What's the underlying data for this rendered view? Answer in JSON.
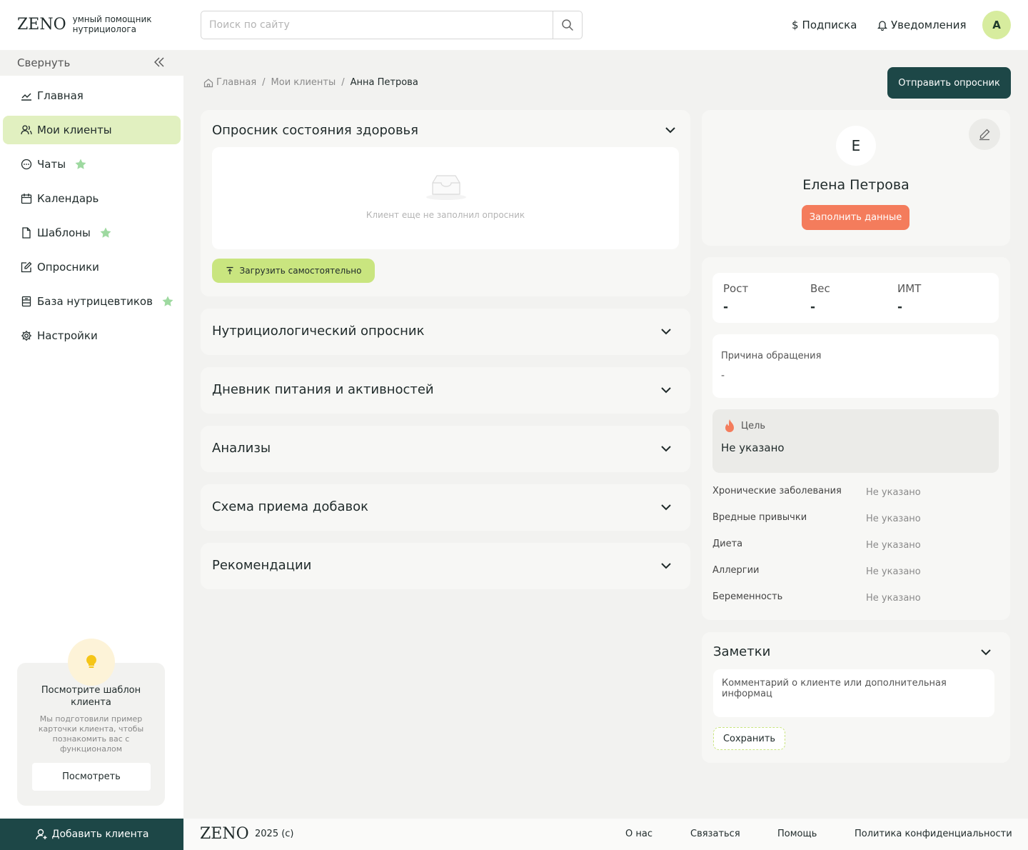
{
  "header": {
    "logo": "ZENO",
    "logo_sub": "умный помощник нутрициолога",
    "search_placeholder": "Поиск по сайту",
    "subscription": "Подписка",
    "notifications": "Уведомления",
    "avatar_letter": "А"
  },
  "sidebar": {
    "collapse_label": "Свернуть",
    "items": [
      {
        "label": "Главная",
        "icon": "chart-line-icon"
      },
      {
        "label": "Мои клиенты",
        "icon": "users-icon"
      },
      {
        "label": "Чаты",
        "icon": "chat-bubble-icon"
      },
      {
        "label": "Календарь",
        "icon": "calendar-icon"
      },
      {
        "label": "Шаблоны",
        "icon": "document-icon"
      },
      {
        "label": "Опросники",
        "icon": "edit-form-icon"
      },
      {
        "label": "База нутрицевтиков",
        "icon": "database-icon"
      },
      {
        "label": "Настройки",
        "icon": "gear-icon"
      }
    ],
    "promo": {
      "title": "Посмотрите шаблон клиента",
      "text": "Мы подготовили пример карточки клиента, чтобы познакомить вас с функционалом",
      "button": "Посмотреть"
    },
    "add_client": "Добавить клиента"
  },
  "breadcrumb": {
    "home": "Главная",
    "clients": "Мои клиенты",
    "current": "Анна Петрова"
  },
  "send_questionnaire": "Отправить опросник",
  "sections": {
    "health": {
      "title": "Опросник  состояния здоровья",
      "empty_text": "Клиент еще не заполнил опросник",
      "upload": "Загрузить самостоятельно"
    },
    "list": [
      "Нутрициологический опросник",
      "Дневник питания и активностей",
      "Анализы",
      "Схема приема добавок",
      "Рекомендации"
    ]
  },
  "profile": {
    "avatar_letter": "Е",
    "name": "Елена Петрова",
    "fill_button": "Заполнить данные",
    "metrics": {
      "height_label": "Рост",
      "height_value": "-",
      "weight_label": "Вес",
      "weight_value": "-",
      "bmi_label": "ИМТ",
      "bmi_value": "-"
    },
    "reason_label": "Причина обращения",
    "reason_value": "-",
    "goal_label": "Цель",
    "goal_value": "Не указано",
    "attributes": [
      {
        "label": "Хронические заболевания",
        "value": "Не указано"
      },
      {
        "label": "Вредные привычки",
        "value": "Не указано"
      },
      {
        "label": "Диета",
        "value": "Не указано"
      },
      {
        "label": "Аллергии",
        "value": "Не указано"
      },
      {
        "label": "Беременность",
        "value": "Не указано"
      }
    ]
  },
  "notes": {
    "title": "Заметки",
    "placeholder": "Комментарий о клиенте или дополнительная информац",
    "save": "Сохранить"
  },
  "footer": {
    "logo": "ZENO",
    "copyright": "2025 (c)",
    "links": [
      "О нас",
      "Связаться",
      "Помощь",
      "Политика конфиденциальности"
    ]
  },
  "colors": {
    "brand_dark": "#1d4747",
    "accent_green": "#c9e57f",
    "active_nav": "#e1f0c0",
    "accent_orange": "#f47c5c"
  }
}
